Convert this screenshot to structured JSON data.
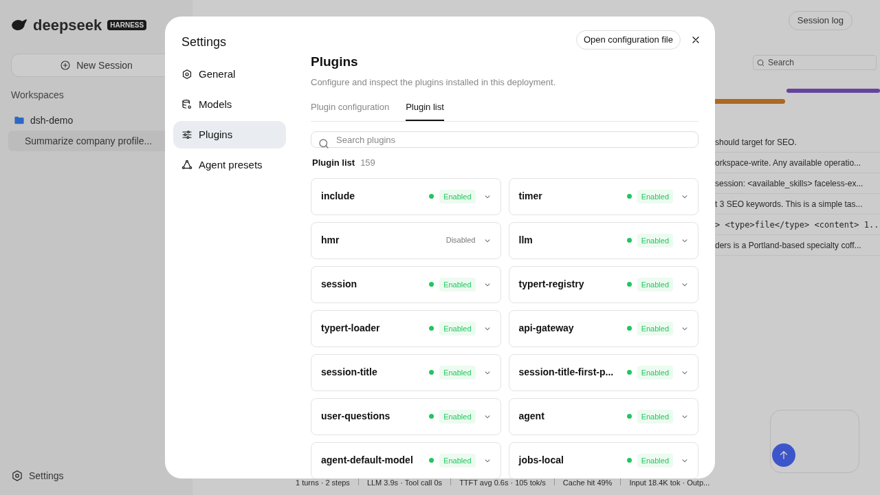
{
  "background": {
    "logo": "deepseek",
    "logo_badge": "HARNESS",
    "new_session": "New Session",
    "workspaces_label": "Workspaces",
    "workspace": "dsh-demo",
    "session": "Summarize company profile...",
    "settings": "Settings",
    "session_log": "Session log",
    "search_placeholder": "Search",
    "lines": [
      {
        "text": "should target for SEO.",
        "kind": "text"
      },
      {
        "text": "orkspace-write. Any available operatio...",
        "kind": "text"
      },
      {
        "text": "session: <available_skills> faceless-ex...",
        "kind": "text"
      },
      {
        "text": "t 3 SEO keywords. This is a simple tas...",
        "kind": "text"
      },
      {
        "text": "> <type>file</type> <content> 1...",
        "kind": "code"
      },
      {
        "text": "ders is a Portland-based specialty coff...",
        "kind": "text"
      }
    ],
    "status_bar": [
      "1 turns · 2 steps",
      "LLM 3.9s · Tool call 0s",
      "TTFT avg 0.6s · 105 tok/s",
      "Cache hit 49%",
      "Input 18.4K tok · Outp..."
    ]
  },
  "dialog": {
    "title": "Settings",
    "open_config": "Open configuration file",
    "nav": [
      {
        "label": "General",
        "kind": "general",
        "selected": false
      },
      {
        "label": "Models",
        "kind": "models",
        "selected": false
      },
      {
        "label": "Plugins",
        "kind": "plugins",
        "selected": true
      },
      {
        "label": "Agent presets",
        "kind": "agents",
        "selected": false
      }
    ],
    "heading": "Plugins",
    "description": "Configure and inspect the plugins installed in this deployment.",
    "tabs": [
      {
        "label": "Plugin configuration",
        "selected": false
      },
      {
        "label": "Plugin list",
        "selected": true
      }
    ],
    "search": {
      "placeholder": "Search plugins"
    },
    "list_title": "Plugin list",
    "count": "159",
    "plugins": [
      {
        "name": "include",
        "status": "Enabled",
        "enabled": true
      },
      {
        "name": "timer",
        "status": "Enabled",
        "enabled": true
      },
      {
        "name": "hmr",
        "status": "Disabled",
        "enabled": false
      },
      {
        "name": "llm",
        "status": "Enabled",
        "enabled": true
      },
      {
        "name": "session",
        "status": "Enabled",
        "enabled": true
      },
      {
        "name": "typert-registry",
        "status": "Enabled",
        "enabled": true
      },
      {
        "name": "typert-loader",
        "status": "Enabled",
        "enabled": true
      },
      {
        "name": "api-gateway",
        "status": "Enabled",
        "enabled": true
      },
      {
        "name": "session-title",
        "status": "Enabled",
        "enabled": true
      },
      {
        "name": "session-title-first-p...",
        "status": "Enabled",
        "enabled": true
      },
      {
        "name": "user-questions",
        "status": "Enabled",
        "enabled": true
      },
      {
        "name": "agent",
        "status": "Enabled",
        "enabled": true
      },
      {
        "name": "agent-default-model",
        "status": "Enabled",
        "enabled": true
      },
      {
        "name": "jobs-local",
        "status": "Enabled",
        "enabled": true
      }
    ]
  }
}
